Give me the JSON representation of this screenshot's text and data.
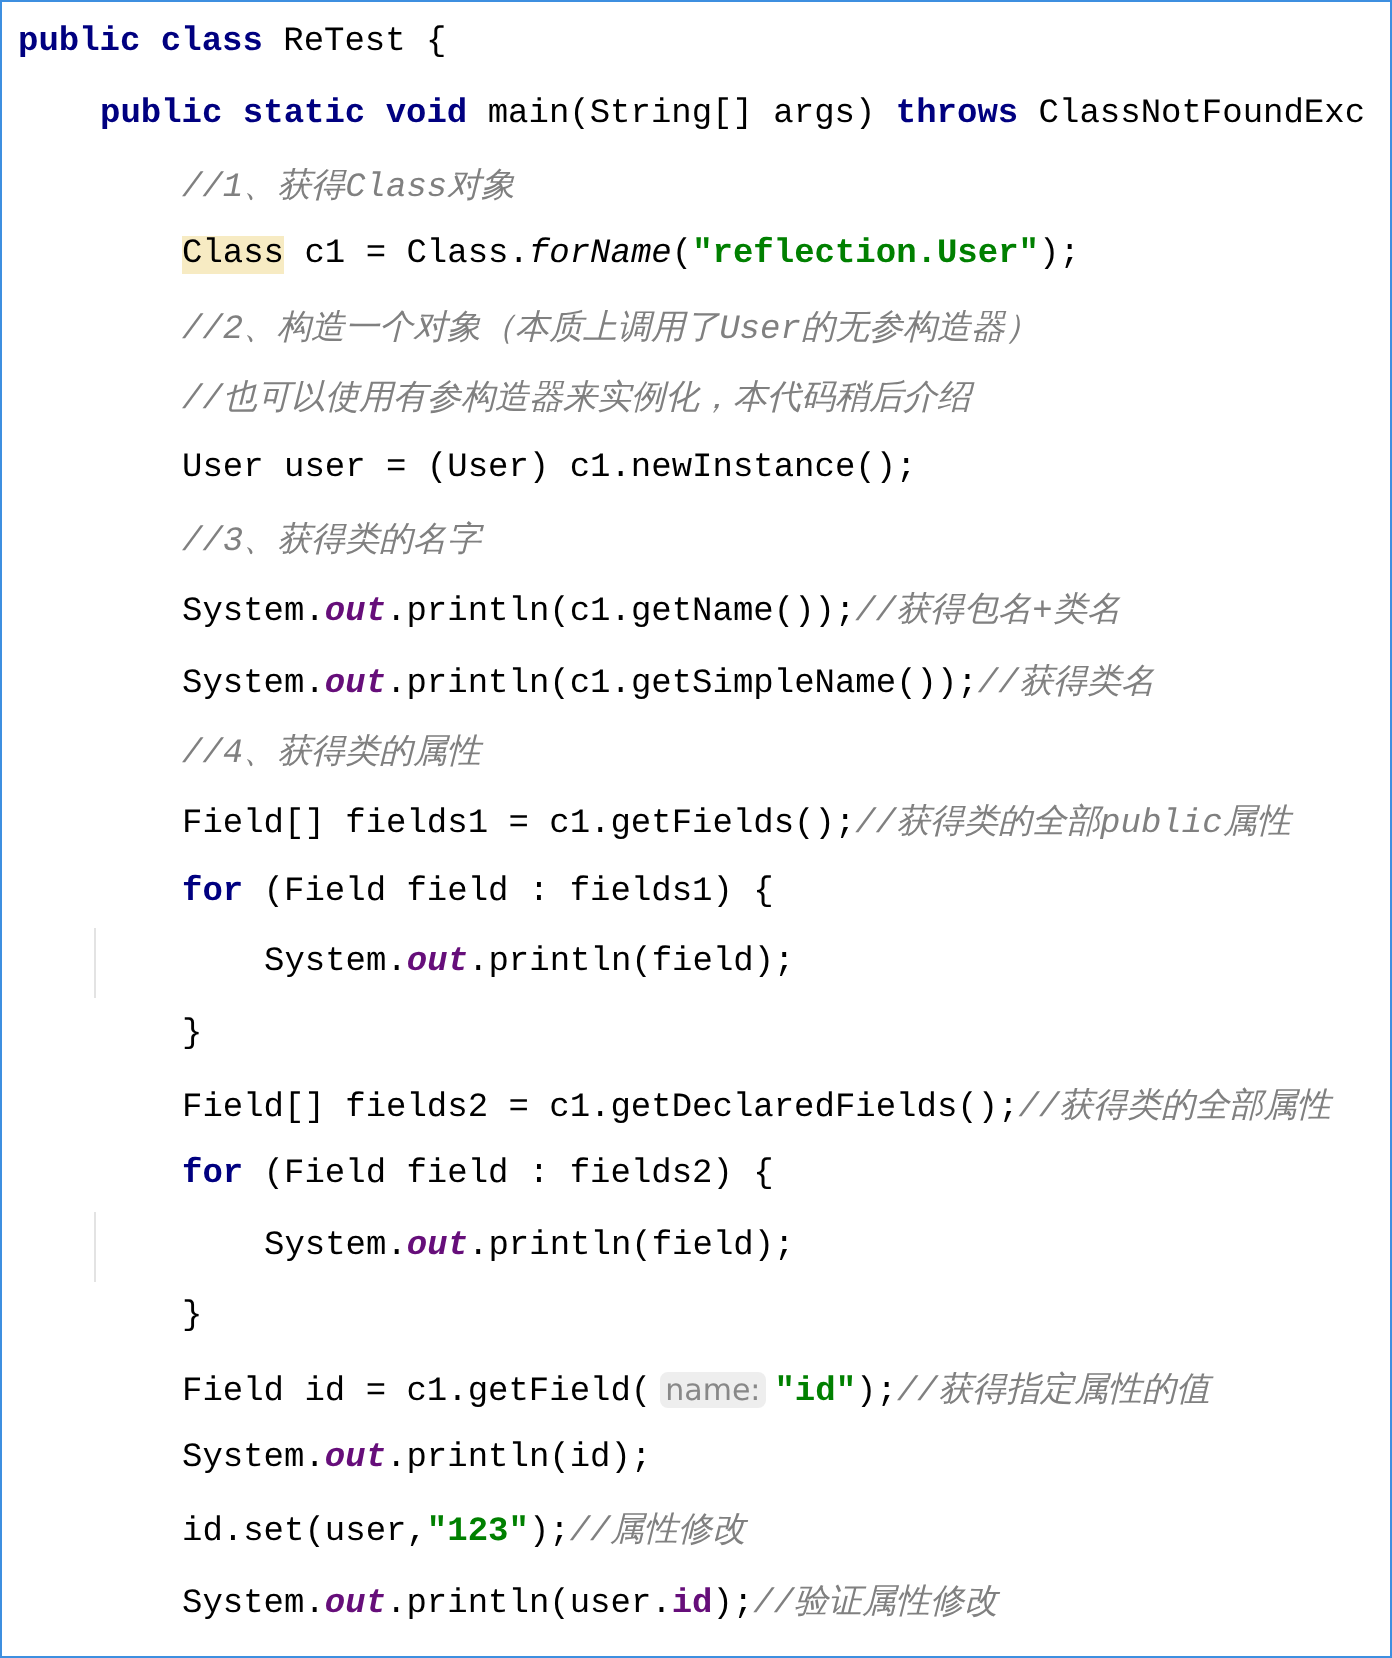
{
  "code": {
    "lines": [
      {
        "tokens": [
          {
            "kind": "keyword",
            "text": "public class"
          },
          {
            "kind": "plain",
            "text": " ReTest {"
          }
        ],
        "children": [
          {
            "tokens": [
              {
                "kind": "keyword",
                "text": "public static void"
              },
              {
                "kind": "plain",
                "text": " main(String[] args) "
              },
              {
                "kind": "keyword",
                "text": "throws"
              },
              {
                "kind": "plain",
                "text": " ClassNotFoundExc"
              }
            ],
            "children": [
              {
                "tokens": [
                  {
                    "kind": "comment",
                    "text": "//1、获得Class对象"
                  }
                ]
              },
              {
                "tokens": [
                  {
                    "kind": "highlight",
                    "text": "Class"
                  },
                  {
                    "kind": "plain",
                    "text": " c1 = Class."
                  },
                  {
                    "kind": "method",
                    "text": "forName"
                  },
                  {
                    "kind": "plain",
                    "text": "("
                  },
                  {
                    "kind": "string",
                    "text": "\"reflection.User\""
                  },
                  {
                    "kind": "plain",
                    "text": ");"
                  }
                ]
              },
              {
                "tokens": [
                  {
                    "kind": "comment",
                    "text": "//2、构造一个对象（本质上调用了User的无参构造器）"
                  }
                ]
              },
              {
                "tokens": [
                  {
                    "kind": "comment",
                    "text": "//也可以使用有参构造器来实例化，本代码稍后介绍"
                  }
                ]
              },
              {
                "tokens": [
                  {
                    "kind": "plain",
                    "text": "User user = (User) c1.newInstance();"
                  }
                ]
              },
              {
                "tokens": [
                  {
                    "kind": "comment",
                    "text": "//3、获得类的名字"
                  }
                ]
              },
              {
                "tokens": [
                  {
                    "kind": "plain",
                    "text": "System."
                  },
                  {
                    "kind": "static",
                    "text": "out"
                  },
                  {
                    "kind": "plain",
                    "text": ".println(c1.getName());"
                  },
                  {
                    "kind": "comment",
                    "text": "//获得包名+类名"
                  }
                ]
              },
              {
                "tokens": [
                  {
                    "kind": "plain",
                    "text": "System."
                  },
                  {
                    "kind": "static",
                    "text": "out"
                  },
                  {
                    "kind": "plain",
                    "text": ".println(c1.getSimpleName());"
                  },
                  {
                    "kind": "comment",
                    "text": "//获得类名"
                  }
                ]
              },
              {
                "tokens": [
                  {
                    "kind": "comment",
                    "text": "//4、获得类的属性"
                  }
                ]
              },
              {
                "tokens": [
                  {
                    "kind": "plain",
                    "text": "Field[] fields1 = c1.getFields();"
                  },
                  {
                    "kind": "comment",
                    "text": "//获得类的全部public属性"
                  }
                ]
              },
              {
                "tokens": [
                  {
                    "kind": "keyword",
                    "text": "for"
                  },
                  {
                    "kind": "plain",
                    "text": " (Field field : fields1) {"
                  }
                ],
                "children": [
                  {
                    "tokens": [
                      {
                        "kind": "plain",
                        "text": "System."
                      },
                      {
                        "kind": "static",
                        "text": "out"
                      },
                      {
                        "kind": "plain",
                        "text": ".println(field);"
                      }
                    ]
                  }
                ]
              },
              {
                "tokens": [
                  {
                    "kind": "plain",
                    "text": "}"
                  }
                ]
              },
              {
                "tokens": [
                  {
                    "kind": "plain",
                    "text": "Field[] fields2 = c1.getDeclaredFields();"
                  },
                  {
                    "kind": "comment",
                    "text": "//获得类的全部属性"
                  }
                ]
              },
              {
                "tokens": [
                  {
                    "kind": "keyword",
                    "text": "for"
                  },
                  {
                    "kind": "plain",
                    "text": " (Field field : fields2) {"
                  }
                ],
                "children": [
                  {
                    "tokens": [
                      {
                        "kind": "plain",
                        "text": "System."
                      },
                      {
                        "kind": "static",
                        "text": "out"
                      },
                      {
                        "kind": "plain",
                        "text": ".println(field);"
                      }
                    ]
                  }
                ]
              },
              {
                "tokens": [
                  {
                    "kind": "plain",
                    "text": "}"
                  }
                ]
              },
              {
                "tokens": [
                  {
                    "kind": "plain",
                    "text": "Field id = c1.getField("
                  },
                  {
                    "kind": "hint",
                    "text": "name:"
                  },
                  {
                    "kind": "string",
                    "text": "\"id\""
                  },
                  {
                    "kind": "plain",
                    "text": ");"
                  },
                  {
                    "kind": "comment",
                    "text": "//获得指定属性的值"
                  }
                ]
              },
              {
                "tokens": [
                  {
                    "kind": "plain",
                    "text": "System."
                  },
                  {
                    "kind": "static",
                    "text": "out"
                  },
                  {
                    "kind": "plain",
                    "text": ".println(id);"
                  }
                ]
              },
              {
                "tokens": [
                  {
                    "kind": "plain",
                    "text": "id.set(user,"
                  },
                  {
                    "kind": "string",
                    "text": "\"123\""
                  },
                  {
                    "kind": "plain",
                    "text": ");"
                  },
                  {
                    "kind": "comment",
                    "text": "//属性修改"
                  }
                ]
              },
              {
                "tokens": [
                  {
                    "kind": "plain",
                    "text": "System."
                  },
                  {
                    "kind": "static",
                    "text": "out"
                  },
                  {
                    "kind": "plain",
                    "text": ".println(user."
                  },
                  {
                    "kind": "field",
                    "text": "id"
                  },
                  {
                    "kind": "plain",
                    "text": ");"
                  },
                  {
                    "kind": "comment",
                    "text": "//验证属性修改"
                  }
                ]
              }
            ]
          }
        ]
      }
    ]
  }
}
